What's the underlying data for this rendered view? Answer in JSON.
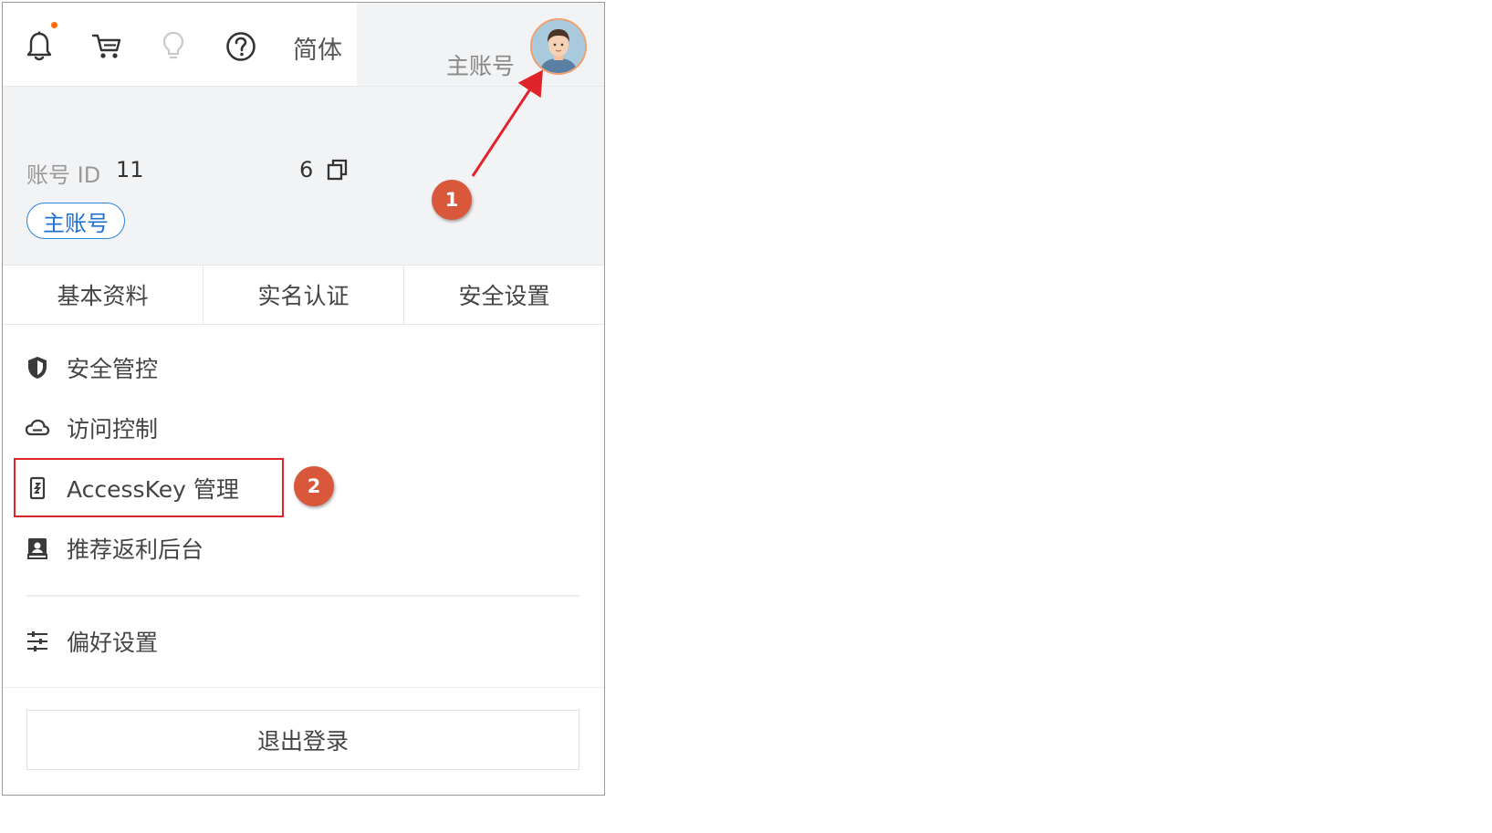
{
  "topbar": {
    "icons": [
      "bell-icon",
      "cart-icon",
      "lightbulb-icon",
      "help-icon"
    ],
    "language": "简体",
    "account_type": "主账号",
    "notification_dot_color": "#ff6a00"
  },
  "account": {
    "id_label": "账号 ID",
    "id_value_prefix": "11",
    "id_value_suffix": "6",
    "badge": "主账号",
    "copy_icon": "copy-icon"
  },
  "tabs": [
    {
      "label": "基本资料"
    },
    {
      "label": "实名认证"
    },
    {
      "label": "安全设置"
    }
  ],
  "menu": {
    "items": [
      {
        "label": "安全管控",
        "icon": "shield-icon"
      },
      {
        "label": "访问控制",
        "icon": "cloud-icon"
      },
      {
        "label": "AccessKey 管理",
        "icon": "key-icon"
      },
      {
        "label": "推荐返利后台",
        "icon": "rebate-icon"
      }
    ],
    "preferences": {
      "label": "偏好设置",
      "icon": "sliders-icon"
    }
  },
  "logout": {
    "label": "退出登录"
  },
  "annotations": {
    "step1": "1",
    "step2": "2",
    "arrow_color": "#e0242c",
    "marker_color": "#d9573a"
  }
}
